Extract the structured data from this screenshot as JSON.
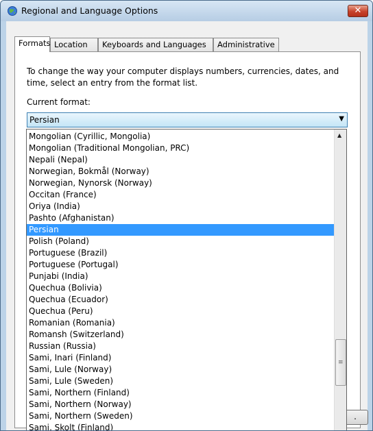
{
  "window": {
    "title": "Regional and Language Options",
    "close_label": "✕"
  },
  "tabs": [
    {
      "label": "Formats",
      "active": true
    },
    {
      "label": "Location",
      "active": false
    },
    {
      "label": "Keyboards and Languages",
      "active": false
    },
    {
      "label": "Administrative",
      "active": false
    }
  ],
  "formats": {
    "description": "To change the way your computer displays numbers, currencies, dates, and time, select an entry from the format list.",
    "current_format_label": "Current format:",
    "current_format_value": "Persian"
  },
  "dropdown": {
    "selected": "Persian",
    "items": [
      "Mongolian (Cyrillic, Mongolia)",
      "Mongolian (Traditional Mongolian, PRC)",
      "Nepali (Nepal)",
      "Norwegian, Bokmål (Norway)",
      "Norwegian, Nynorsk (Norway)",
      "Occitan (France)",
      "Oriya (India)",
      "Pashto (Afghanistan)",
      "Persian",
      "Polish (Poland)",
      "Portuguese (Brazil)",
      "Portuguese (Portugal)",
      "Punjabi (India)",
      "Quechua (Bolivia)",
      "Quechua (Ecuador)",
      "Quechua (Peru)",
      "Romanian (Romania)",
      "Romansh (Switzerland)",
      "Russian (Russia)",
      "Sami, Inari (Finland)",
      "Sami, Lule (Norway)",
      "Sami, Lule (Sweden)",
      "Sami, Northern (Finland)",
      "Sami, Northern (Norway)",
      "Sami, Northern (Sweden)",
      "Sami, Skolt (Finland)"
    ]
  },
  "bottom_button": {
    "label": "."
  },
  "icons": {
    "title_icon": "globe-icon",
    "close_icon": "close-icon",
    "dropdown_arrow": "chevron-down-icon",
    "scroll_up": "scroll-up-icon",
    "scroll_grip": "grip-icon"
  }
}
